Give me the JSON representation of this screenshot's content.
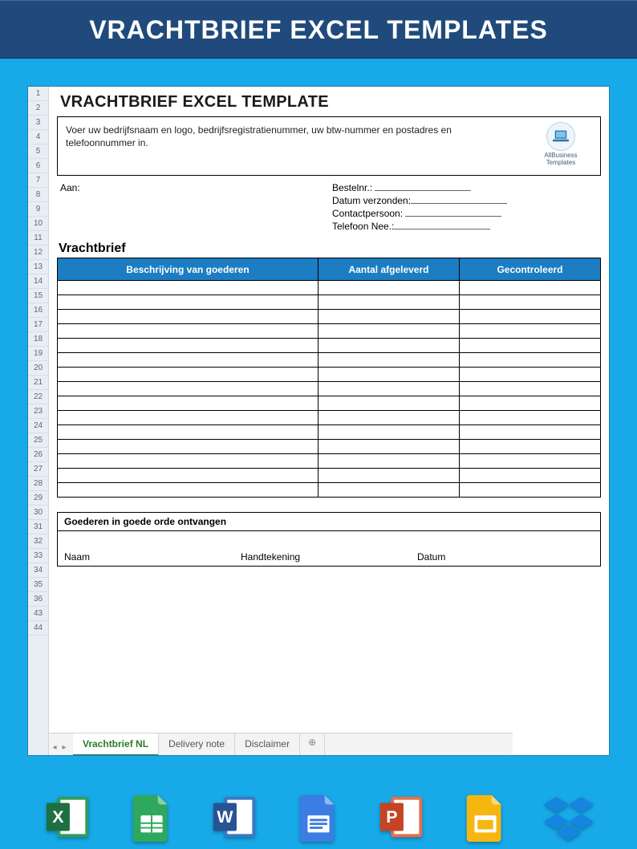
{
  "titleBar": {
    "heading": "VRACHTBRIEF EXCEL TEMPLATES"
  },
  "rowNumbers": [
    "1",
    "2",
    "3",
    "4",
    "5",
    "6",
    "7",
    "8",
    "9",
    "10",
    "11",
    "12",
    "13",
    "14",
    "15",
    "16",
    "17",
    "18",
    "19",
    "20",
    "21",
    "22",
    "23",
    "24",
    "25",
    "26",
    "27",
    "28",
    "29",
    "30",
    "31",
    "32",
    "33",
    "34",
    "35",
    "36",
    "43",
    "44"
  ],
  "doc": {
    "heading": "VRACHTBRIEF EXCEL TEMPLATE",
    "companyBoxText": "Voer uw bedrijfsnaam en logo, bedrijfsregistratienummer, uw btw-nummer en postadres en telefoonnummer in.",
    "badgeLine1": "AllBusiness",
    "badgeLine2": "Templates",
    "aanLabel": "Aan:",
    "bestelLabel": "Bestelnr.:",
    "datumLabel": "Datum verzonden:",
    "contactLabel": "Contactpersoon:",
    "telefoonLabel": "Telefoon Nee.:",
    "sectionHeading": "Vrachtbrief",
    "cols": {
      "c1": "Beschrijving van goederen",
      "c2": "Aantal afgeleverd",
      "c3": "Gecontroleerd"
    },
    "dataRows": 15,
    "receipt": {
      "heading": "Goederen in goede orde ontvangen",
      "naam": "Naam",
      "handtekening": "Handtekening",
      "datum": "Datum"
    }
  },
  "tabs": {
    "items": [
      {
        "label": "Vrachtbrief NL",
        "active": true
      },
      {
        "label": "Delivery note",
        "active": false
      },
      {
        "label": "Disclaimer",
        "active": false
      }
    ],
    "add": "⊕"
  },
  "apps": [
    {
      "name": "excel-icon",
      "fill": "#1e6f42",
      "accent": "#2e9e5b",
      "letter": "X"
    },
    {
      "name": "gsheets-icon",
      "fill": "#2fa85e",
      "accent": "#ffffff",
      "letter": "▦"
    },
    {
      "name": "word-icon",
      "fill": "#285394",
      "accent": "#3c78c3",
      "letter": "W"
    },
    {
      "name": "gdocs-icon",
      "fill": "#3b7de3",
      "accent": "#ffffff",
      "letter": "≡"
    },
    {
      "name": "powerpoint-icon",
      "fill": "#c44423",
      "accent": "#e2714a",
      "letter": "P"
    },
    {
      "name": "gslides-icon",
      "fill": "#f5b70f",
      "accent": "#ffffff",
      "letter": "▭"
    },
    {
      "name": "dropbox-icon",
      "fill": "#1585e0",
      "accent": "#1585e0",
      "letter": "◆"
    }
  ]
}
